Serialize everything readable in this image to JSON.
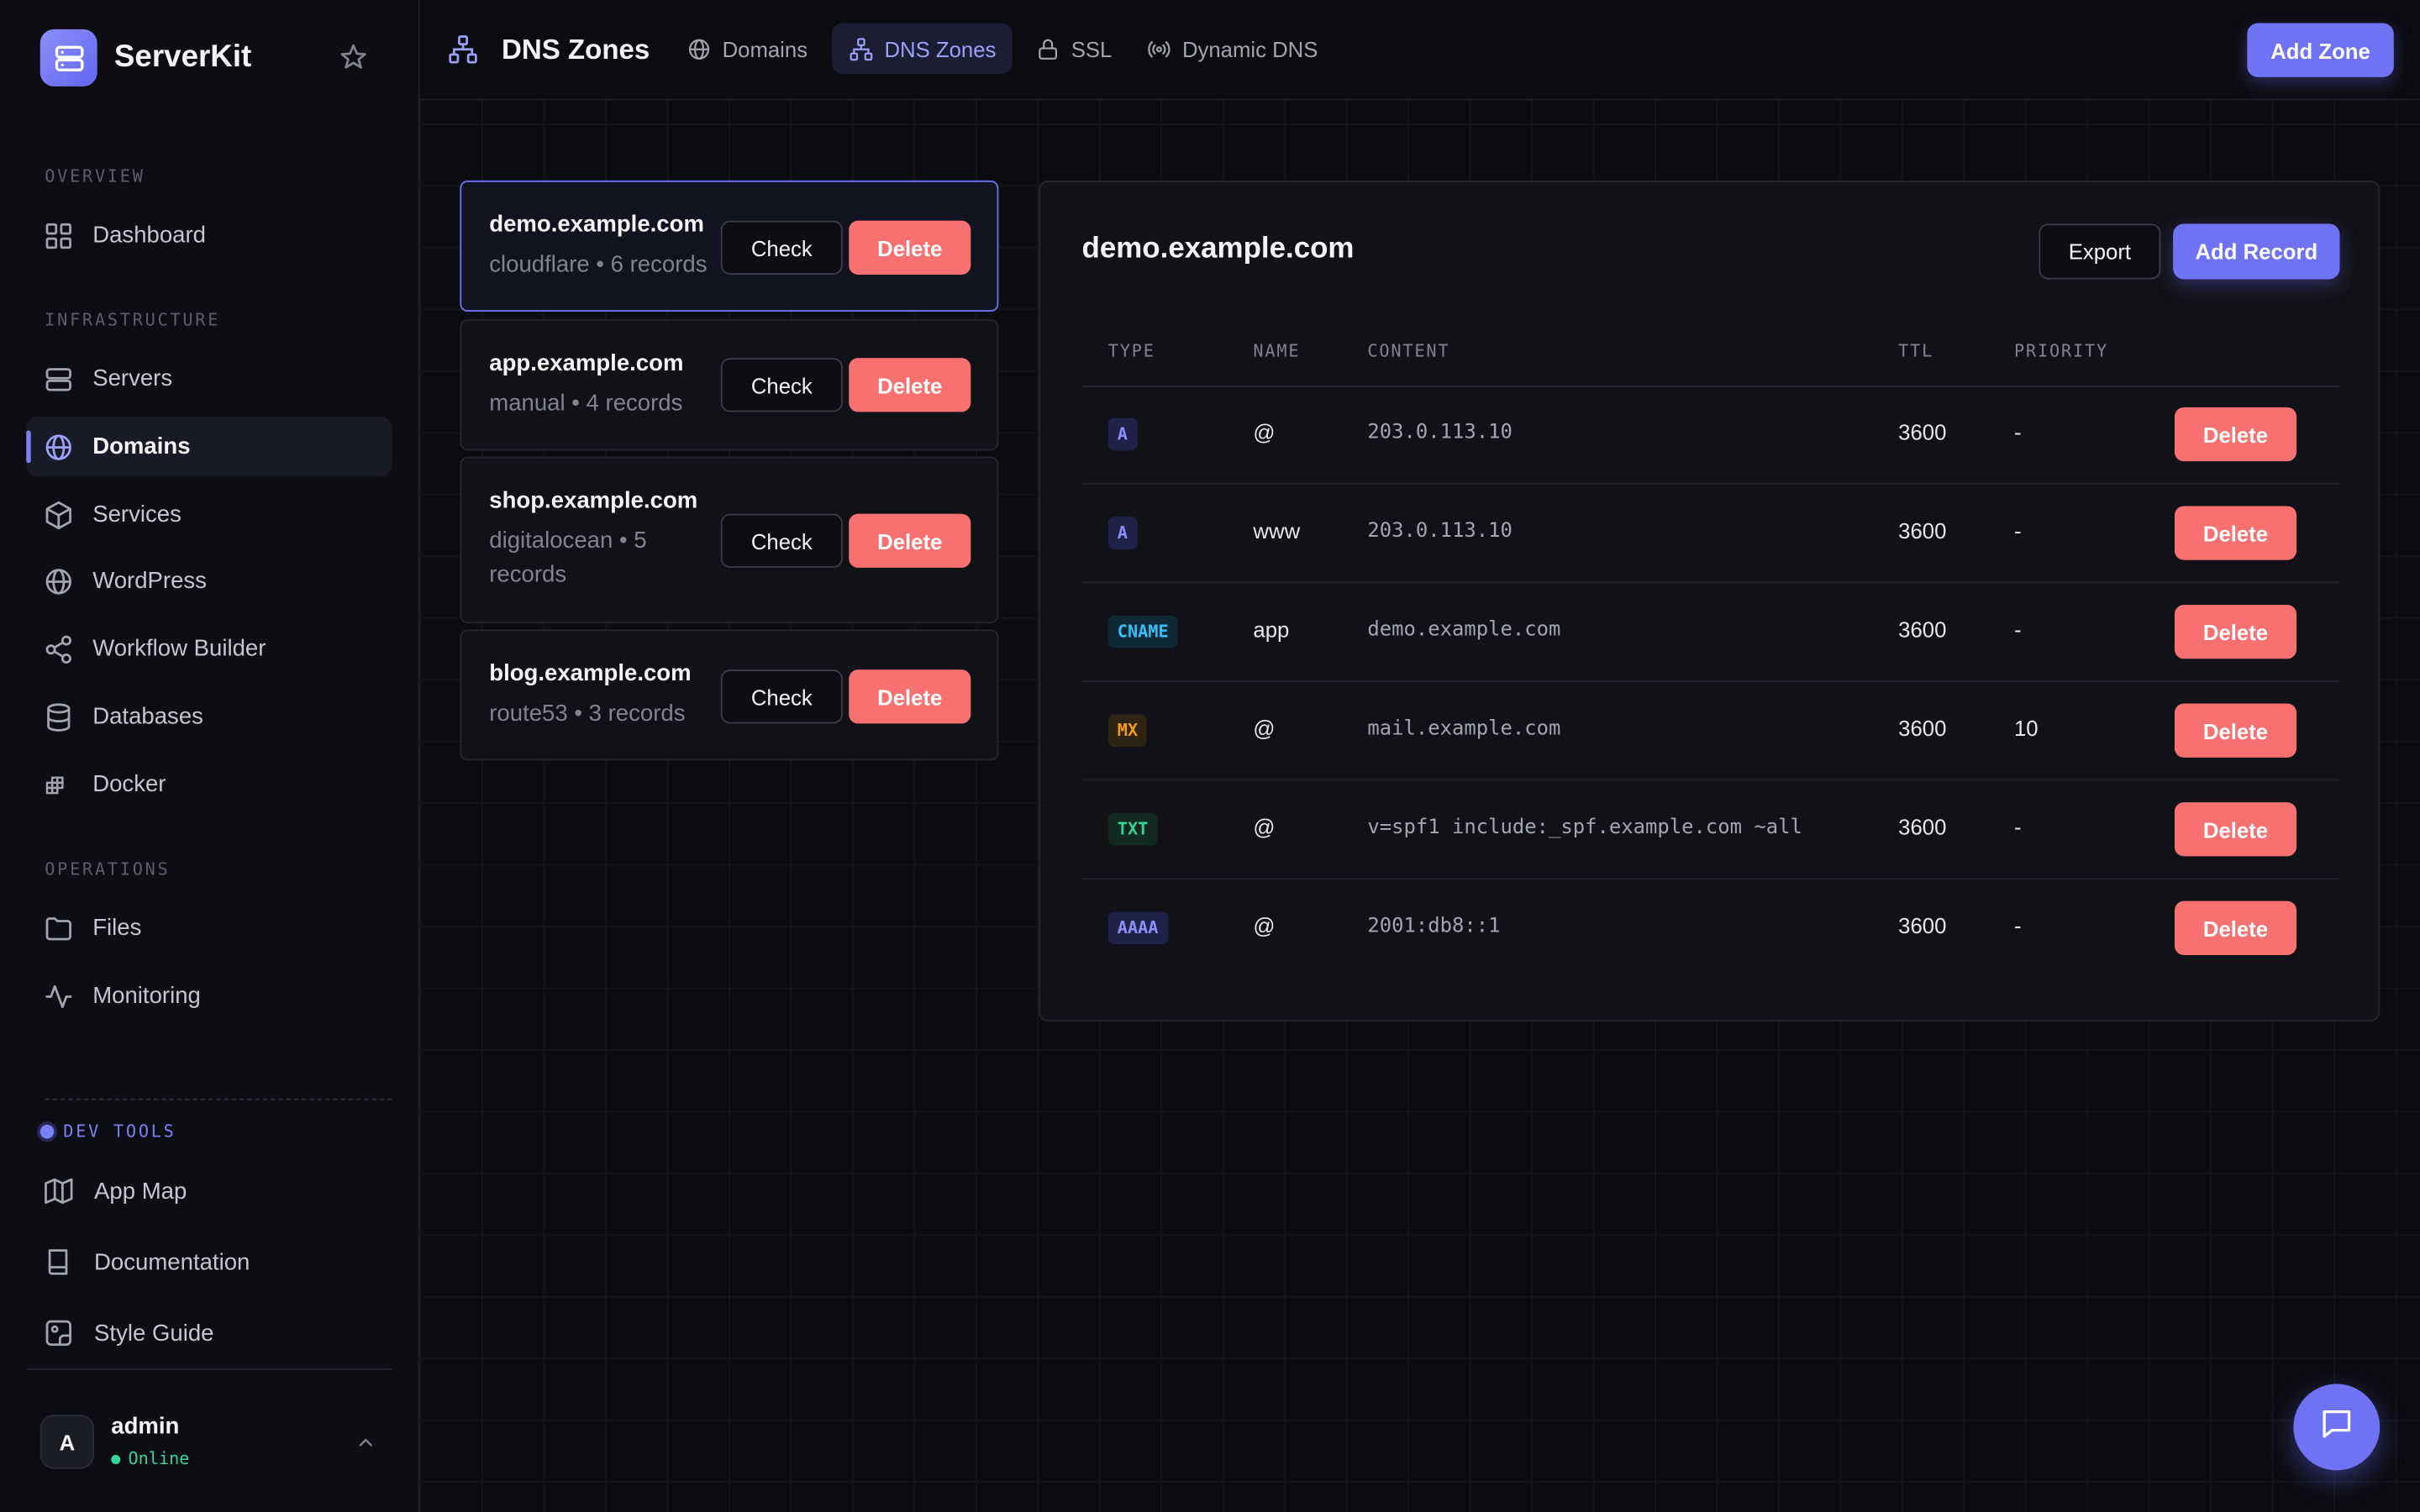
{
  "app": {
    "name": "ServerKit"
  },
  "sidebar": {
    "sections": [
      {
        "label": "OVERVIEW",
        "items": [
          {
            "label": "Dashboard",
            "icon": "dashboard-icon"
          }
        ]
      },
      {
        "label": "INFRASTRUCTURE",
        "items": [
          {
            "label": "Servers",
            "icon": "server-icon"
          },
          {
            "label": "Domains",
            "icon": "globe-icon",
            "active": true
          },
          {
            "label": "Services",
            "icon": "box-icon"
          },
          {
            "label": "WordPress",
            "icon": "globe-icon"
          },
          {
            "label": "Workflow Builder",
            "icon": "share-icon"
          },
          {
            "label": "Databases",
            "icon": "database-icon"
          },
          {
            "label": "Docker",
            "icon": "docker-icon"
          }
        ]
      },
      {
        "label": "OPERATIONS",
        "items": [
          {
            "label": "Files",
            "icon": "folder-icon"
          },
          {
            "label": "Monitoring",
            "icon": "activity-icon"
          }
        ]
      }
    ],
    "dev_tools": {
      "label": "DEV TOOLS",
      "items": [
        {
          "label": "App Map",
          "icon": "map-icon"
        },
        {
          "label": "Documentation",
          "icon": "book-icon"
        },
        {
          "label": "Style Guide",
          "icon": "palette-icon"
        }
      ]
    },
    "user": {
      "initial": "A",
      "name": "admin",
      "status": "Online"
    }
  },
  "header": {
    "title": "DNS Zones",
    "tabs": [
      {
        "label": "Domains",
        "icon": "globe-icon"
      },
      {
        "label": "DNS Zones",
        "icon": "network-icon",
        "active": true
      },
      {
        "label": "SSL",
        "icon": "lock-icon"
      },
      {
        "label": "Dynamic DNS",
        "icon": "broadcast-icon"
      }
    ],
    "add_zone_label": "Add Zone"
  },
  "zones": [
    {
      "name": "demo.example.com",
      "meta": "cloudflare • 6 records",
      "selected": true
    },
    {
      "name": "app.example.com",
      "meta": "manual • 4 records"
    },
    {
      "name": "shop.example.com",
      "meta_line1": "digitalocean • 5",
      "meta_line2": "records"
    },
    {
      "name": "blog.example.com",
      "meta": "route53 • 3 records"
    }
  ],
  "zone_actions": {
    "check_label": "Check",
    "delete_label": "Delete"
  },
  "records_panel": {
    "title": "demo.example.com",
    "export_label": "Export",
    "add_record_label": "Add Record",
    "columns": {
      "type": "TYPE",
      "name": "NAME",
      "content": "CONTENT",
      "ttl": "TTL",
      "priority": "PRIORITY"
    },
    "rows": [
      {
        "type": "A",
        "name": "@",
        "content": "203.0.113.10",
        "ttl": "3600",
        "priority": "-"
      },
      {
        "type": "A",
        "name": "www",
        "content": "203.0.113.10",
        "ttl": "3600",
        "priority": "-"
      },
      {
        "type": "CNAME",
        "name": "app",
        "content": "demo.example.com",
        "ttl": "3600",
        "priority": "-"
      },
      {
        "type": "MX",
        "name": "@",
        "content": "mail.example.com",
        "ttl": "3600",
        "priority": "10"
      },
      {
        "type": "TXT",
        "name": "@",
        "content": "v=spf1 include:_spf.example.com ~all",
        "ttl": "3600",
        "priority": "-"
      },
      {
        "type": "AAAA",
        "name": "@",
        "content": "2001:db8::1",
        "ttl": "3600",
        "priority": "-"
      }
    ],
    "delete_label": "Delete"
  },
  "colors": {
    "accent": "#6f73f3",
    "danger": "#f87171",
    "online": "#34d399",
    "badge_A": "#8b8ff8",
    "badge_CNAME": "#38bdf8",
    "badge_MX": "#f59e0b",
    "badge_TXT": "#34d399",
    "badge_AAAA": "#8b8ff8"
  }
}
